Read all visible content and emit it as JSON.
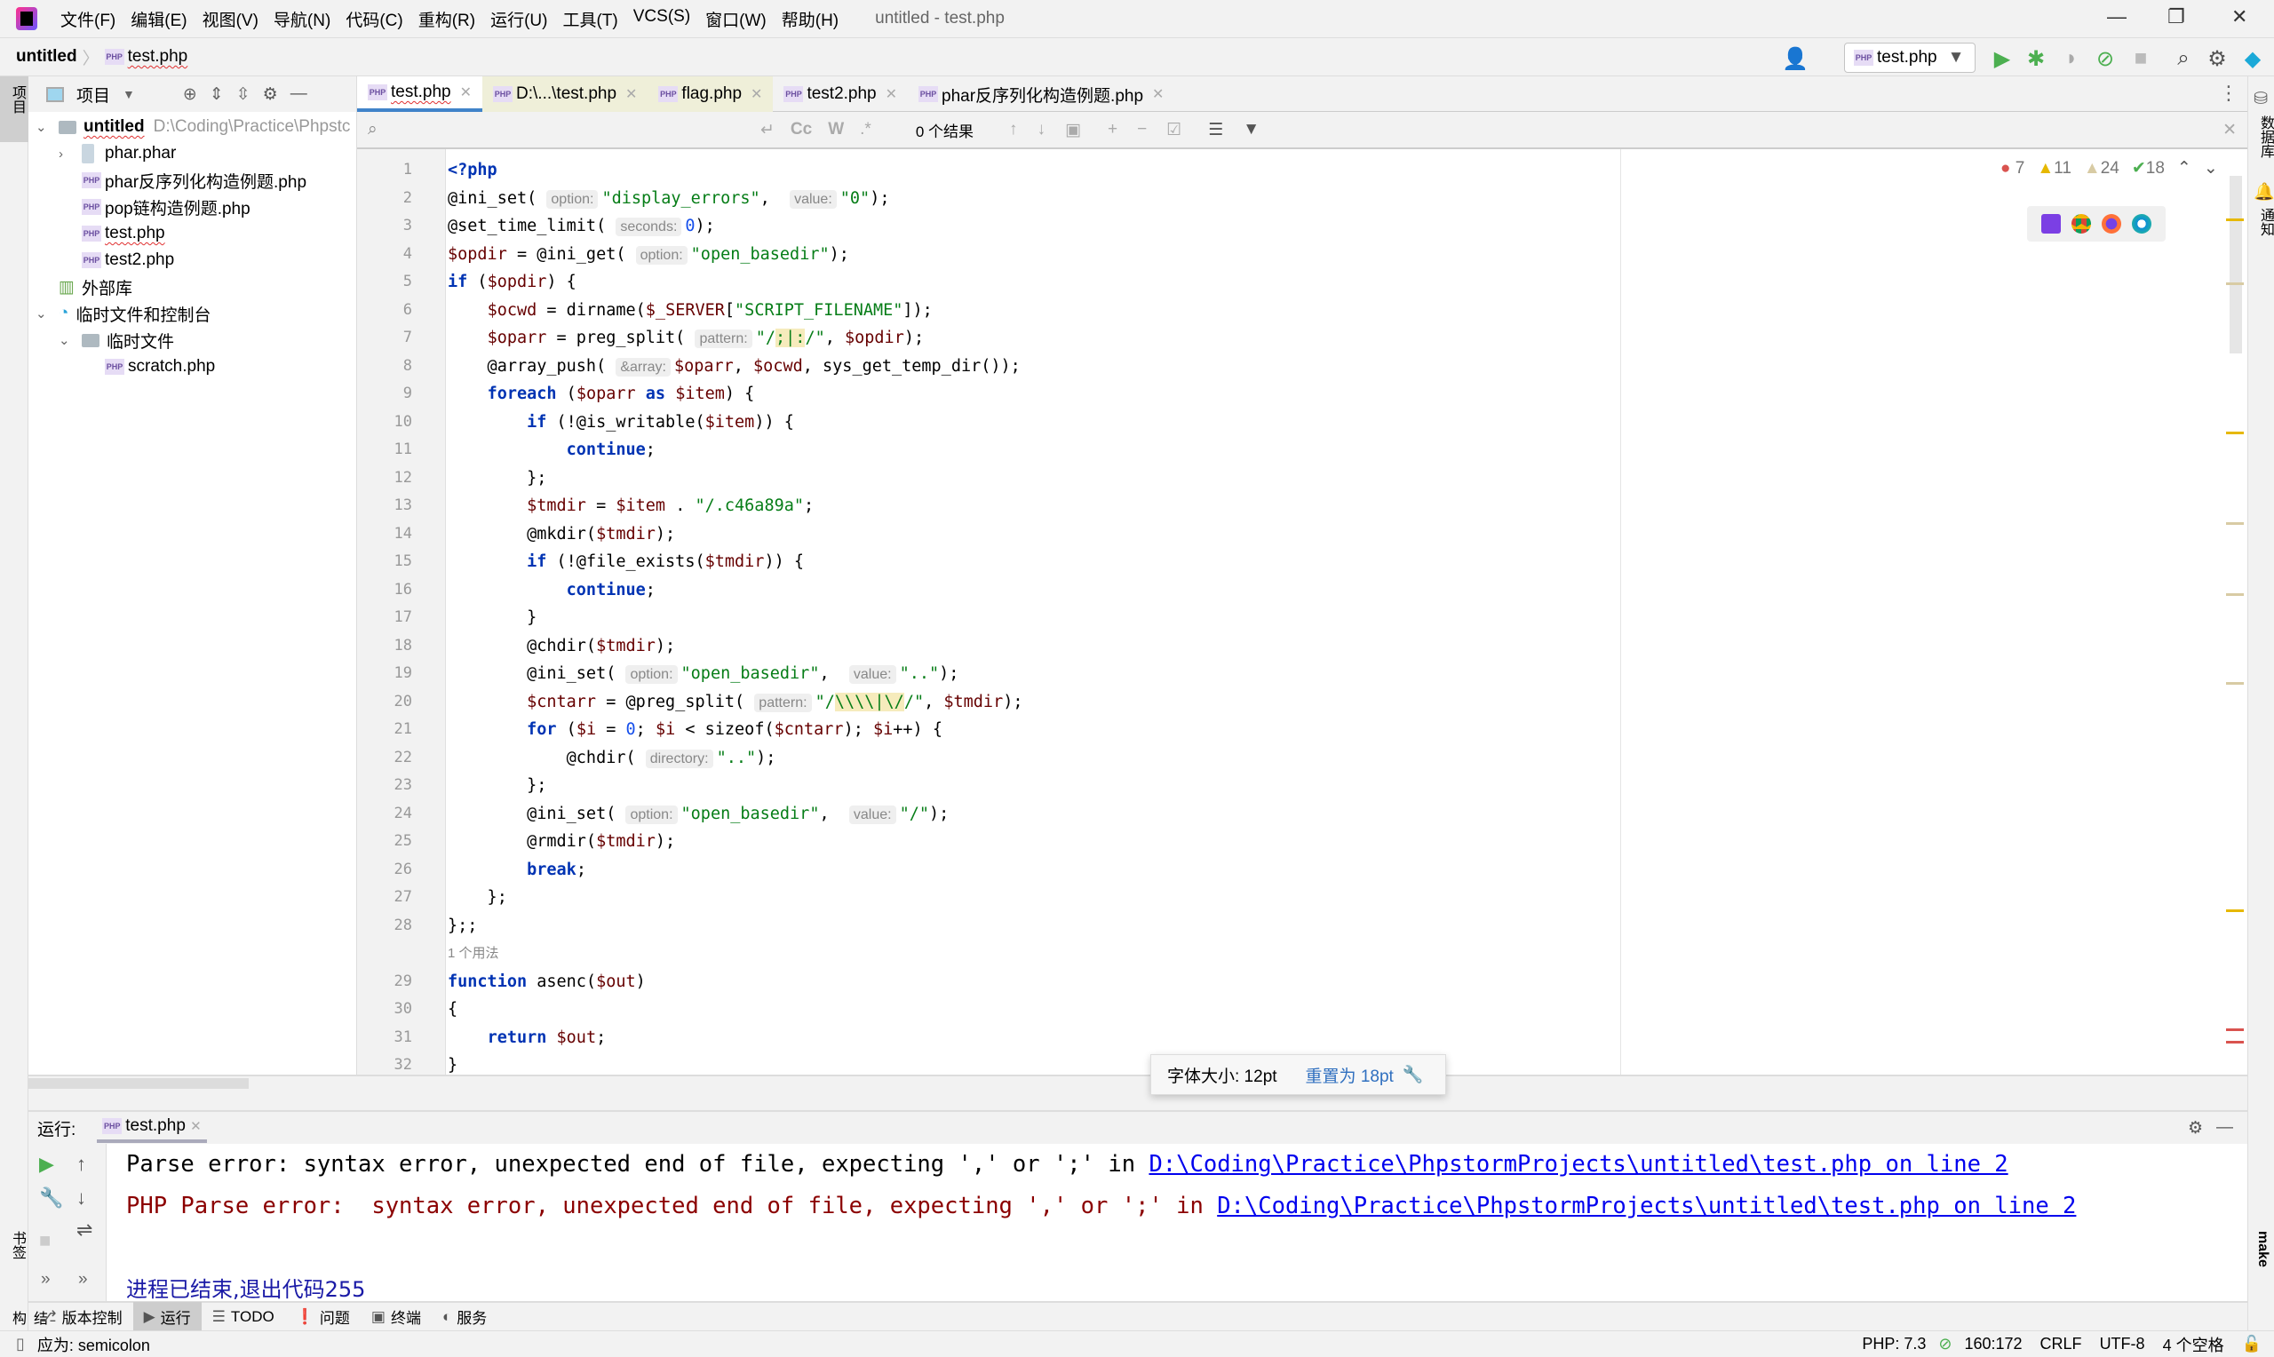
{
  "menubar": {
    "items": [
      "文件(F)",
      "编辑(E)",
      "视图(V)",
      "导航(N)",
      "代码(C)",
      "重构(R)",
      "运行(U)",
      "工具(T)",
      "VCS(S)",
      "窗口(W)",
      "帮助(H)"
    ],
    "title": "untitled - test.php"
  },
  "breadcrumb": {
    "project": "untitled",
    "file": "test.php"
  },
  "toolbar": {
    "run_config": "test.php"
  },
  "left_strip": {
    "project": "项目",
    "bookmarks": "书签",
    "structure": "结构"
  },
  "right_strip": {
    "database": "数据库",
    "notifications": "通知",
    "make": "make"
  },
  "project_panel": {
    "title": "项目",
    "tree": [
      {
        "label": "untitled",
        "path": "D:\\Coding\\Practice\\Phpstc",
        "depth": 0,
        "arrow": "v",
        "icon": "folder",
        "bold": true
      },
      {
        "label": "phar.phar",
        "depth": 1,
        "arrow": ">",
        "icon": "archive"
      },
      {
        "label": "phar反序列化构造例题.php",
        "depth": 1,
        "icon": "php"
      },
      {
        "label": "pop链构造例题.php",
        "depth": 1,
        "icon": "php"
      },
      {
        "label": "test.php",
        "depth": 1,
        "icon": "php",
        "squig": true
      },
      {
        "label": "test2.php",
        "depth": 1,
        "icon": "php"
      },
      {
        "label": "外部库",
        "depth": 0,
        "icon": "library"
      },
      {
        "label": "临时文件和控制台",
        "depth": 0,
        "arrow": "v",
        "icon": "scratch"
      },
      {
        "label": "临时文件",
        "depth": 1,
        "arrow": "v",
        "icon": "folder"
      },
      {
        "label": "scratch.php",
        "depth": 2,
        "icon": "php"
      }
    ]
  },
  "editor_tabs": [
    {
      "label": "test.php",
      "active": true
    },
    {
      "label": "D:\\...\\test.php",
      "yellow": true
    },
    {
      "label": "flag.php",
      "yellow": true
    },
    {
      "label": "test2.php"
    },
    {
      "label": "phar反序列化构造例题.php"
    }
  ],
  "find": {
    "placeholder": "",
    "results": "0 个结果",
    "cc": "Cc",
    "w": "W",
    "regex": ".*"
  },
  "inspections": {
    "errors": "7",
    "warnings": "11",
    "weak_warnings": "24",
    "typos": "18"
  },
  "code_lines": [
    {
      "n": "1",
      "s": [
        [
          "kw",
          "<?php"
        ]
      ]
    },
    {
      "n": "2",
      "s": [
        [
          "fn",
          "@ini_set( "
        ],
        [
          "hint",
          "option:"
        ],
        [
          "str",
          "\"display_errors\""
        ],
        [
          "fn",
          ",  "
        ],
        [
          "hint",
          "value:"
        ],
        [
          "str",
          "\"0\""
        ],
        [
          "fn",
          ");"
        ]
      ]
    },
    {
      "n": "3",
      "s": [
        [
          "fn",
          "@set_time_limit( "
        ],
        [
          "hint",
          "seconds:"
        ],
        [
          "num",
          "0"
        ],
        [
          "fn",
          ");"
        ]
      ]
    },
    {
      "n": "4",
      "s": [
        [
          "var",
          "$opdir"
        ],
        [
          "fn",
          " = @ini_get( "
        ],
        [
          "hint",
          "option:"
        ],
        [
          "str",
          "\"open_basedir\""
        ],
        [
          "fn",
          ");"
        ]
      ]
    },
    {
      "n": "5",
      "s": [
        [
          "kw",
          "if"
        ],
        [
          "fn",
          " ("
        ],
        [
          "var",
          "$opdir"
        ],
        [
          "fn",
          ") {"
        ]
      ]
    },
    {
      "n": "6",
      "s": [
        [
          "fn",
          "    "
        ],
        [
          "var",
          "$ocwd"
        ],
        [
          "fn",
          " = dirname("
        ],
        [
          "var",
          "$_SERVER"
        ],
        [
          "fn",
          "["
        ],
        [
          "str",
          "\"SCRIPT_FILENAME\""
        ],
        [
          "fn",
          "]);"
        ]
      ]
    },
    {
      "n": "7",
      "s": [
        [
          "fn",
          "    "
        ],
        [
          "var",
          "$oparr"
        ],
        [
          "fn",
          " = preg_split( "
        ],
        [
          "hint",
          "pattern:"
        ],
        [
          "str",
          "\"/"
        ],
        [
          "hl",
          ";|:"
        ],
        [
          "str",
          "/\""
        ],
        [
          "fn",
          ", "
        ],
        [
          "var",
          "$opdir"
        ],
        [
          "fn",
          ");"
        ]
      ]
    },
    {
      "n": "8",
      "s": [
        [
          "fn",
          "    @array_push( "
        ],
        [
          "hint",
          "&array:"
        ],
        [
          "var",
          "$oparr"
        ],
        [
          "fn",
          ", "
        ],
        [
          "var",
          "$ocwd"
        ],
        [
          "fn",
          ", sys_get_temp_dir());"
        ]
      ]
    },
    {
      "n": "9",
      "s": [
        [
          "fn",
          "    "
        ],
        [
          "kw",
          "foreach"
        ],
        [
          "fn",
          " ("
        ],
        [
          "var",
          "$oparr"
        ],
        [
          "kw",
          " as "
        ],
        [
          "var",
          "$item"
        ],
        [
          "fn",
          ") {"
        ]
      ]
    },
    {
      "n": "10",
      "s": [
        [
          "fn",
          "        "
        ],
        [
          "kw",
          "if"
        ],
        [
          "fn",
          " (!@is_writable("
        ],
        [
          "var",
          "$item"
        ],
        [
          "fn",
          ")) {"
        ]
      ]
    },
    {
      "n": "11",
      "s": [
        [
          "fn",
          "            "
        ],
        [
          "kw",
          "continue"
        ],
        [
          "fn",
          ";"
        ]
      ]
    },
    {
      "n": "12",
      "s": [
        [
          "fn",
          "        };"
        ]
      ]
    },
    {
      "n": "13",
      "s": [
        [
          "fn",
          "        "
        ],
        [
          "var",
          "$tmdir"
        ],
        [
          "fn",
          " = "
        ],
        [
          "var",
          "$item"
        ],
        [
          "fn",
          " . "
        ],
        [
          "str",
          "\"/.c46a89a\""
        ],
        [
          "fn",
          ";"
        ]
      ]
    },
    {
      "n": "14",
      "s": [
        [
          "fn",
          "        @mkdir("
        ],
        [
          "var",
          "$tmdir"
        ],
        [
          "fn",
          ");"
        ]
      ]
    },
    {
      "n": "15",
      "s": [
        [
          "fn",
          "        "
        ],
        [
          "kw",
          "if"
        ],
        [
          "fn",
          " (!@file_exists("
        ],
        [
          "var",
          "$tmdir"
        ],
        [
          "fn",
          ")) {"
        ]
      ]
    },
    {
      "n": "16",
      "s": [
        [
          "fn",
          "            "
        ],
        [
          "kw",
          "continue"
        ],
        [
          "fn",
          ";"
        ]
      ]
    },
    {
      "n": "17",
      "s": [
        [
          "fn",
          "        }"
        ]
      ]
    },
    {
      "n": "18",
      "s": [
        [
          "fn",
          "        @chdir("
        ],
        [
          "var",
          "$tmdir"
        ],
        [
          "fn",
          ");"
        ]
      ]
    },
    {
      "n": "19",
      "s": [
        [
          "fn",
          "        @ini_set( "
        ],
        [
          "hint",
          "option:"
        ],
        [
          "str",
          "\"open_basedir\""
        ],
        [
          "fn",
          ",  "
        ],
        [
          "hint",
          "value:"
        ],
        [
          "str",
          "\"..\""
        ],
        [
          "fn",
          ");"
        ]
      ]
    },
    {
      "n": "20",
      "s": [
        [
          "fn",
          "        "
        ],
        [
          "var",
          "$cntarr"
        ],
        [
          "fn",
          " = @preg_split( "
        ],
        [
          "hint",
          "pattern:"
        ],
        [
          "str",
          "\"/"
        ],
        [
          "hl",
          "\\\\\\\\|\\/"
        ],
        [
          "str",
          "/\""
        ],
        [
          "fn",
          ", "
        ],
        [
          "var",
          "$tmdir"
        ],
        [
          "fn",
          ");"
        ]
      ]
    },
    {
      "n": "21",
      "s": [
        [
          "fn",
          "        "
        ],
        [
          "kw",
          "for"
        ],
        [
          "fn",
          " ("
        ],
        [
          "var",
          "$i"
        ],
        [
          "fn",
          " = "
        ],
        [
          "num",
          "0"
        ],
        [
          "fn",
          "; "
        ],
        [
          "var",
          "$i"
        ],
        [
          "fn",
          " < sizeof("
        ],
        [
          "var",
          "$cntarr"
        ],
        [
          "fn",
          "); "
        ],
        [
          "var",
          "$i"
        ],
        [
          "fn",
          "++) {"
        ]
      ]
    },
    {
      "n": "22",
      "s": [
        [
          "fn",
          "            @chdir( "
        ],
        [
          "hint",
          "directory:"
        ],
        [
          "str",
          "\"..\""
        ],
        [
          "fn",
          ");"
        ]
      ]
    },
    {
      "n": "23",
      "s": [
        [
          "fn",
          "        };"
        ]
      ]
    },
    {
      "n": "24",
      "s": [
        [
          "fn",
          "        @ini_set( "
        ],
        [
          "hint",
          "option:"
        ],
        [
          "str",
          "\"open_basedir\""
        ],
        [
          "fn",
          ",  "
        ],
        [
          "hint",
          "value:"
        ],
        [
          "str",
          "\"/\""
        ],
        [
          "fn",
          ");"
        ]
      ]
    },
    {
      "n": "25",
      "s": [
        [
          "fn",
          "        @rmdir("
        ],
        [
          "var",
          "$tmdir"
        ],
        [
          "fn",
          ");"
        ]
      ]
    },
    {
      "n": "26",
      "s": [
        [
          "fn",
          "        "
        ],
        [
          "kw",
          "break"
        ],
        [
          "fn",
          ";"
        ]
      ]
    },
    {
      "n": "27",
      "s": [
        [
          "fn",
          "    };"
        ]
      ]
    },
    {
      "n": "28",
      "s": [
        [
          "fn",
          "};;"
        ]
      ]
    },
    {
      "usage": "1 个用法"
    },
    {
      "n": "29",
      "s": [
        [
          "kw",
          "function"
        ],
        [
          "fn",
          " asenc("
        ],
        [
          "var",
          "$out"
        ],
        [
          "fn",
          ")"
        ]
      ]
    },
    {
      "n": "30",
      "s": [
        [
          "fn",
          "{"
        ]
      ]
    },
    {
      "n": "31",
      "s": [
        [
          "fn",
          "    "
        ],
        [
          "kw",
          "return"
        ],
        [
          "fn",
          " "
        ],
        [
          "var",
          "$out"
        ],
        [
          "fn",
          ";"
        ]
      ]
    },
    {
      "n": "32",
      "s": [
        [
          "fn",
          "}"
        ]
      ]
    }
  ],
  "font_popup": {
    "size": "字体大小: 12pt",
    "reset": "重置为 18pt"
  },
  "run_panel": {
    "label": "运行:",
    "tab": "test.php",
    "line1": "Parse error: syntax error, unexpected end of file, expecting ',' or ';' in ",
    "line2": "PHP Parse error:  syntax error, unexpected end of file, expecting ',' or ';' in ",
    "link": "D:\\Coding\\Practice\\PhpstormProjects\\untitled\\test.php on line 2",
    "exit": "进程已结束,退出代码255"
  },
  "bottom_tabs": [
    {
      "label": "版本控制",
      "icon": "⎇"
    },
    {
      "label": "运行",
      "icon": "▶",
      "active": true
    },
    {
      "label": "TODO",
      "icon": "☰"
    },
    {
      "label": "问题",
      "icon": "❗"
    },
    {
      "label": "终端",
      "icon": "▣"
    },
    {
      "label": "服务",
      "icon": "◐"
    }
  ],
  "status": {
    "message": "应为: semicolon",
    "php": "PHP: 7.3",
    "position": "160:172",
    "line_ending": "CRLF",
    "encoding": "UTF-8",
    "indent": "4 个空格"
  },
  "colors": {
    "accent": "#4083c9",
    "keyword": "#0033b3",
    "string": "#067d17",
    "variable": "#660000",
    "error": "#8b0000",
    "link": "#0000ee"
  }
}
